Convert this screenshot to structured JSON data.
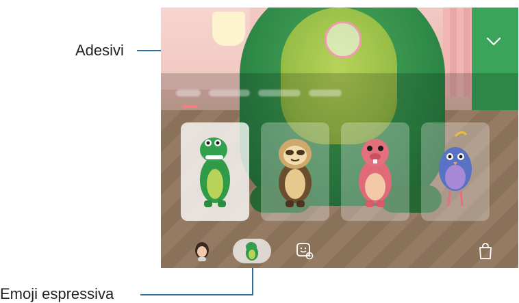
{
  "callouts": {
    "stickers_label": "Adesivi",
    "expressive_emoji_label": "Emoji espressiva"
  },
  "camera": {
    "shutter_icon": "shutter-button",
    "collapse_icon": "chevron-down"
  },
  "emoji_list": [
    {
      "name": "green dinosaur",
      "selected": true
    },
    {
      "name": "sloth",
      "selected": false
    },
    {
      "name": "pink mole",
      "selected": false
    },
    {
      "name": "blue bird",
      "selected": false
    }
  ],
  "bottom_tabs": [
    {
      "name": "my-emoji",
      "icon": "avatar-icon",
      "active": false
    },
    {
      "name": "expressive-emoji",
      "icon": "dino-icon",
      "active": true
    },
    {
      "name": "emoji-camera",
      "icon": "face-settings-icon",
      "active": false
    },
    {
      "name": "store",
      "icon": "shopping-bag-icon",
      "active": false
    }
  ],
  "colors": {
    "callout_line": "#2b6f9f",
    "category_indicator": "#f0817f",
    "shutter_ring": "#f19ab0"
  }
}
